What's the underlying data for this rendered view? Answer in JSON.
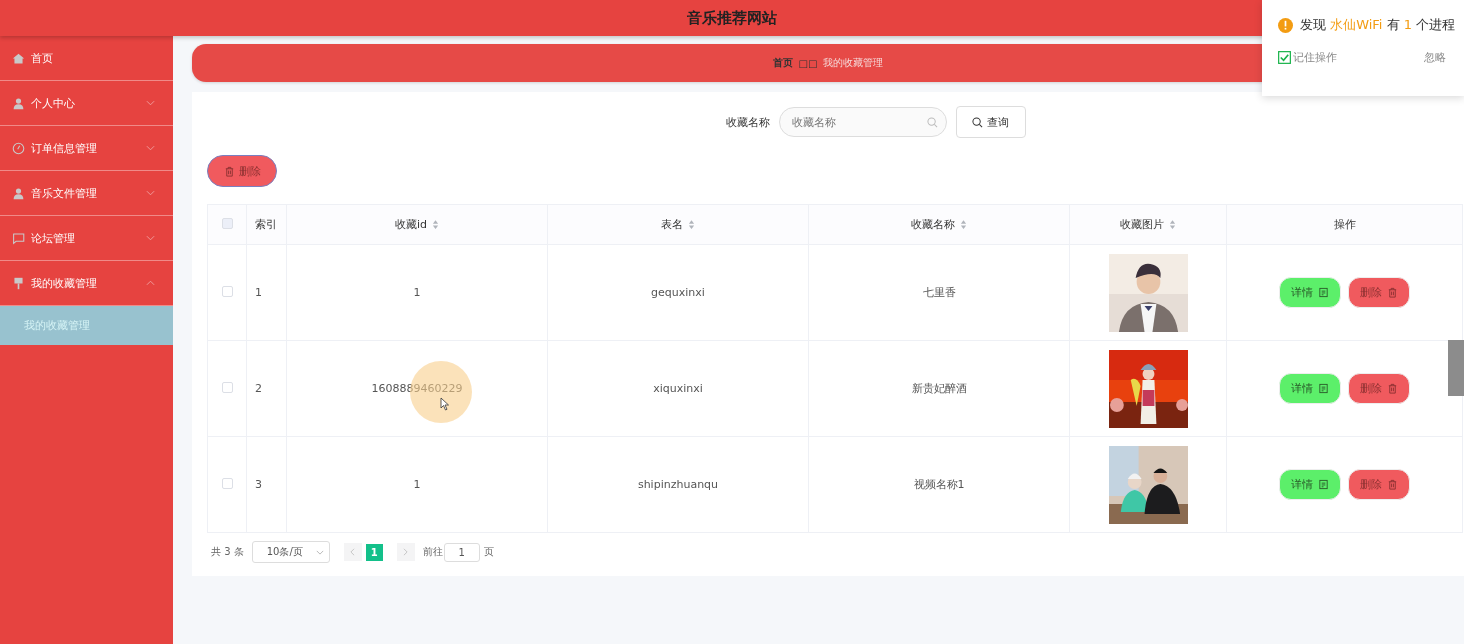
{
  "header": {
    "title": "音乐推荐网站"
  },
  "sidebar": {
    "items": [
      {
        "label": "首页"
      },
      {
        "label": "个人中心",
        "expanded": false
      },
      {
        "label": "订单信息管理",
        "expanded": false
      },
      {
        "label": "音乐文件管理",
        "expanded": false
      },
      {
        "label": "论坛管理",
        "expanded": false
      },
      {
        "label": "我的收藏管理",
        "expanded": true,
        "children": [
          {
            "label": "我的收藏管理",
            "selected": true
          }
        ]
      }
    ]
  },
  "breadcrumb": {
    "home": "首页",
    "separator": "□□",
    "current": "我的收藏管理"
  },
  "search": {
    "label": "收藏名称",
    "placeholder": "收藏名称",
    "button": "查询"
  },
  "bulk_delete": "删除",
  "table": {
    "select_all_checked": false,
    "columns": [
      {
        "label": "索引",
        "sortable": false
      },
      {
        "label": "收藏id",
        "sortable": true
      },
      {
        "label": "表名",
        "sortable": true
      },
      {
        "label": "收藏名称",
        "sortable": true
      },
      {
        "label": "收藏图片",
        "sortable": true
      },
      {
        "label": "操作",
        "sortable": false
      }
    ],
    "rows": [
      {
        "checked": false,
        "index": "1",
        "id": "1",
        "table": "gequxinxi",
        "name": "七里香",
        "detail": "详情",
        "delete": "删除"
      },
      {
        "checked": false,
        "index": "2",
        "id": "1608889460229",
        "table": "xiquxinxi",
        "name": "新贵妃醉酒",
        "detail": "详情",
        "delete": "删除"
      },
      {
        "checked": false,
        "index": "3",
        "id": "1",
        "table": "shipinzhuanqu",
        "name": "视频名称1",
        "detail": "详情",
        "delete": "删除"
      }
    ]
  },
  "pagination": {
    "total": "共 3 条",
    "page_size": "10条/页",
    "pages": [
      {
        "label": "1",
        "selected": true
      }
    ],
    "goto_label": "前往",
    "goto_value": "1",
    "goto_suffix": "页"
  },
  "notification": {
    "message": [
      {
        "text": "发现 ",
        "kind": "plain"
      },
      {
        "text": "水仙WiFi",
        "kind": "highlight"
      },
      {
        "text": " 有 ",
        "kind": "plain"
      },
      {
        "text": "1",
        "kind": "highlight"
      },
      {
        "text": " 个进程",
        "kind": "plain"
      }
    ],
    "remember": {
      "label": "记住操作",
      "checked": true
    },
    "ignore": "忽略"
  }
}
